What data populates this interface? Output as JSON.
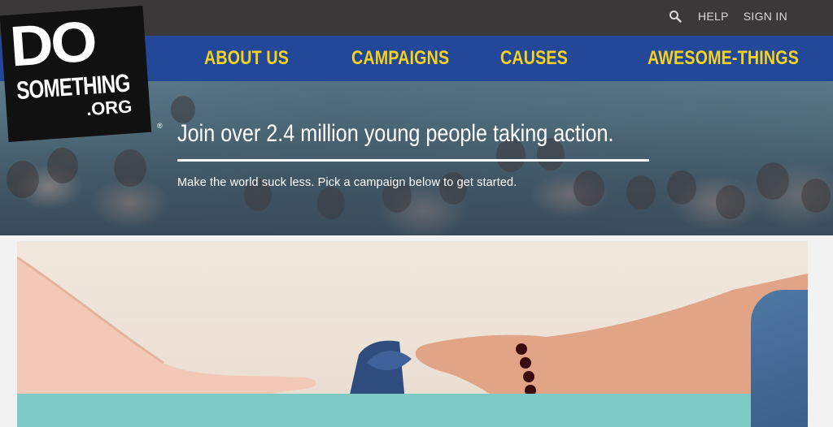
{
  "utility_nav": {
    "search_icon": "search-icon",
    "help_label": "HELP",
    "signin_label": "SIGN IN"
  },
  "main_nav": {
    "items": [
      {
        "label": "ABOUT US"
      },
      {
        "label": "CAMPAIGNS"
      },
      {
        "label": "CAUSES"
      },
      {
        "label": "AWESOME-THINGS"
      }
    ]
  },
  "logo": {
    "line1": "DO",
    "line2": "SOMETHING",
    "line3": ".ORG",
    "registered": "®"
  },
  "hero": {
    "headline": "Join over 2.4 million young people taking action.",
    "subtext": "Make the world suck less. Pick a campaign below to get started."
  },
  "colors": {
    "topbar": "#3a3838",
    "navbar": "#23489a",
    "nav_text": "#f5d21b",
    "feature_band": "#7ecbc6"
  }
}
